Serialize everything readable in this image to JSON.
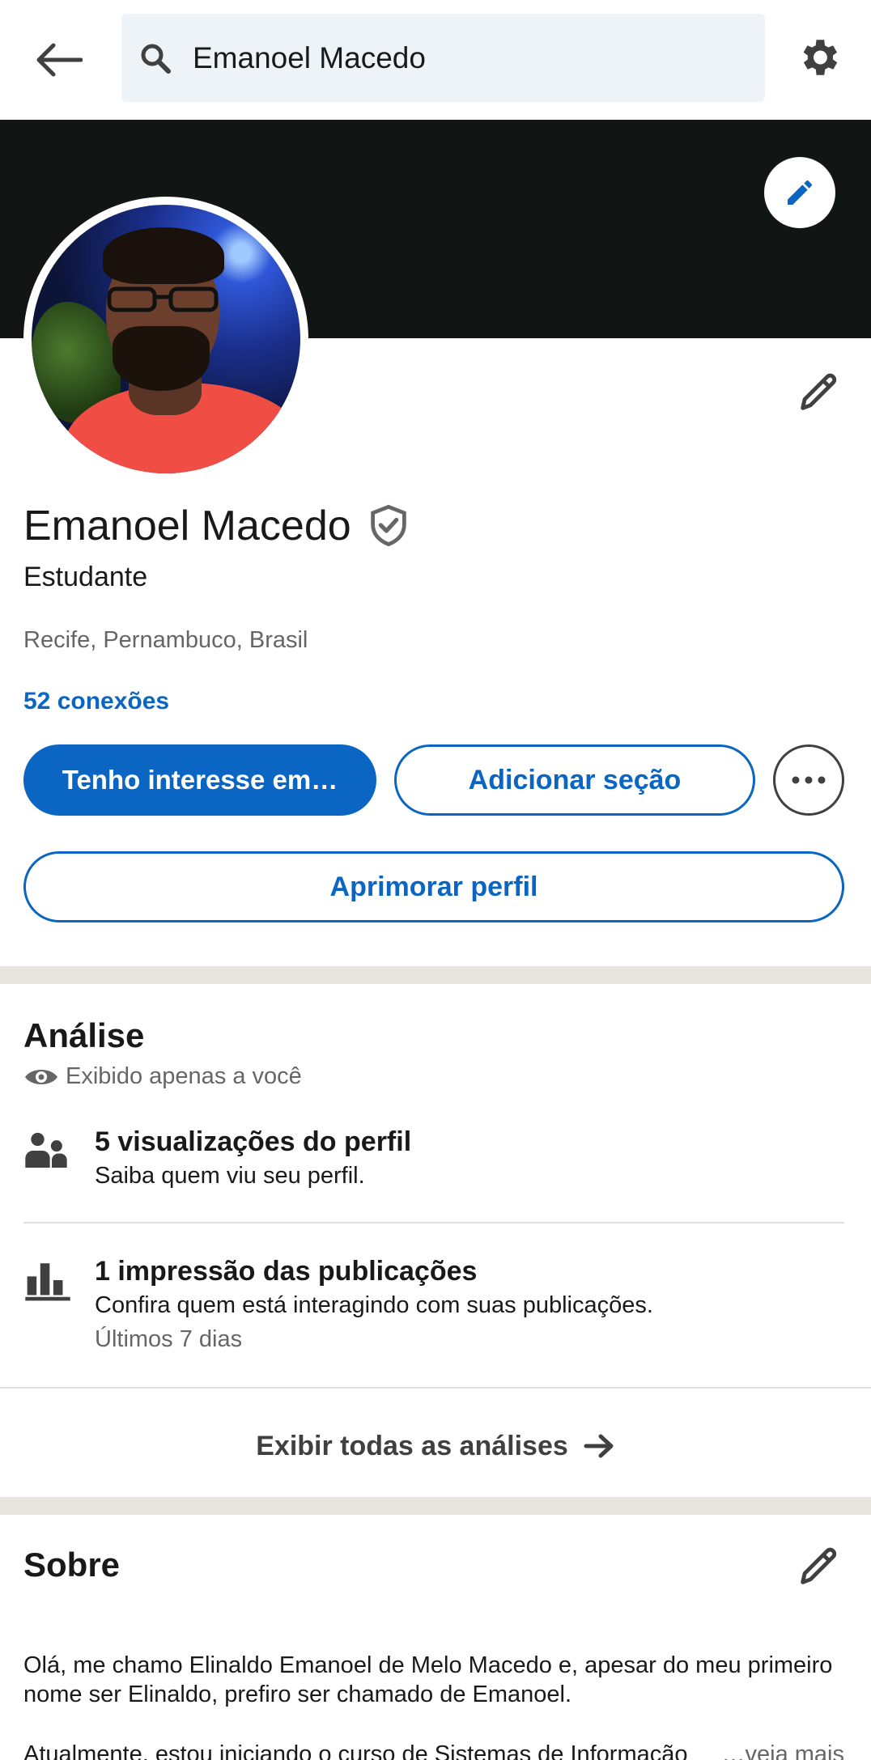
{
  "search": {
    "query": "Emanoel Macedo"
  },
  "profile": {
    "name": "Emanoel Macedo",
    "headline": "Estudante",
    "location": "Recife, Pernambuco, Brasil",
    "connections": "52 conexões"
  },
  "actions": {
    "interest": "Tenho interesse em…",
    "add_section": "Adicionar seção",
    "improve": "Aprimorar perfil"
  },
  "analysis": {
    "title": "Análise",
    "private_note": "Exibido apenas a você",
    "items": [
      {
        "icon": "people-icon",
        "title": "5 visualizações do perfil",
        "subtitle": "Saiba quem viu seu perfil.",
        "meta": ""
      },
      {
        "icon": "bar-chart-icon",
        "title": "1 impressão das publicações",
        "subtitle": "Confira quem está interagindo com suas publicações.",
        "meta": "Últimos 7 dias"
      }
    ],
    "show_all": "Exibir todas as análises"
  },
  "about": {
    "title": "Sobre",
    "text": "Olá, me chamo Elinaldo Emanoel de Melo Macedo e, apesar do meu primeiro nome ser Elinaldo, prefiro ser chamado de Emanoel.",
    "text2": "Atualmente, estou iniciando o curso de Sistemas de Informação",
    "see_more": "…veja mais"
  },
  "colors": {
    "accent": "#0a66c2",
    "cover": "#111614",
    "band": "#e9e5df"
  }
}
